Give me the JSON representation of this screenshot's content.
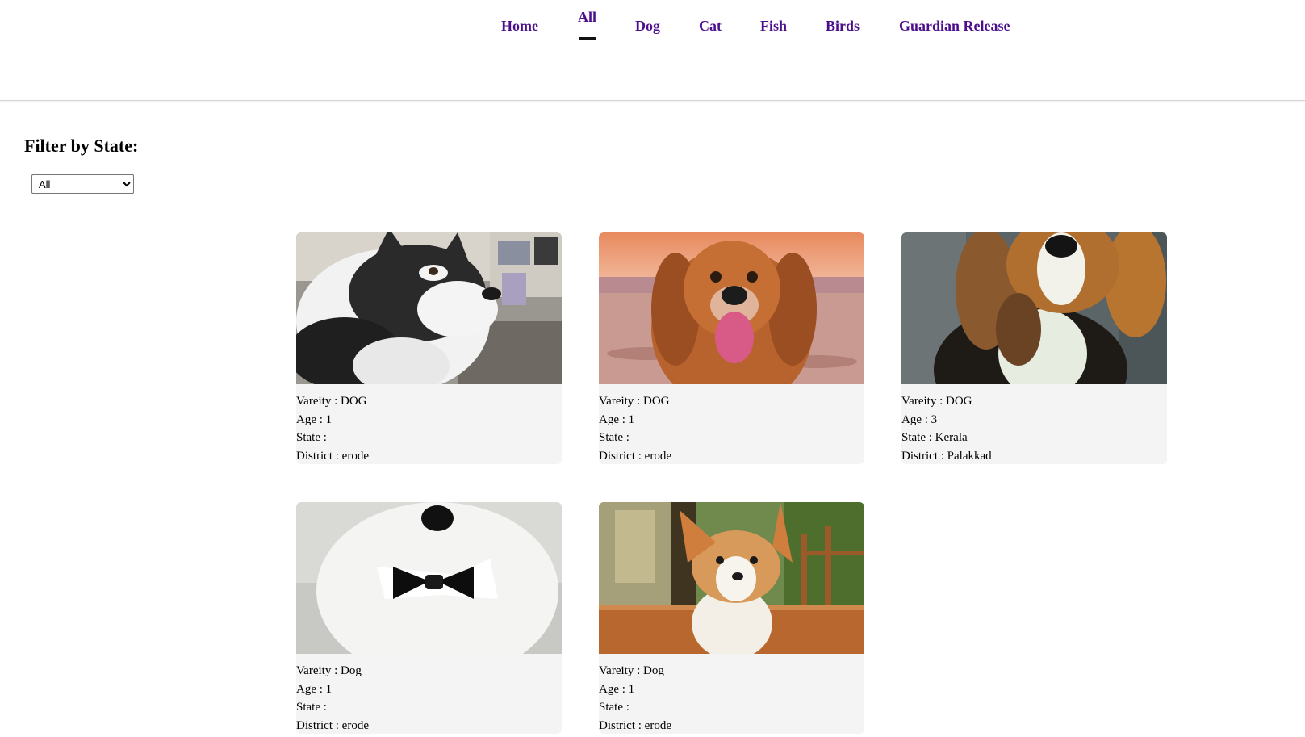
{
  "nav": {
    "items": [
      {
        "label": "Home",
        "active": false
      },
      {
        "label": "All",
        "active": true
      },
      {
        "label": "Dog",
        "active": false
      },
      {
        "label": "Cat",
        "active": false
      },
      {
        "label": "Fish",
        "active": false
      },
      {
        "label": "Birds",
        "active": false
      },
      {
        "label": "Guardian Release",
        "active": false
      }
    ],
    "link_color": "#4b0f8c"
  },
  "filter": {
    "title": "Filter by State:",
    "selected": "All"
  },
  "pets": [
    {
      "image": "husky-puppy-photo",
      "variety_label": "Vareity : ",
      "variety": "DOG",
      "age_label": "Age : ",
      "age": "1",
      "state_label": "State : ",
      "state": "",
      "district_label": "District : ",
      "district": "erode"
    },
    {
      "image": "golden-retriever-beach-photo",
      "variety_label": "Vareity : ",
      "variety": "DOG",
      "age_label": "Age : ",
      "age": "1",
      "state_label": "State : ",
      "state": "",
      "district_label": "District : ",
      "district": "erode"
    },
    {
      "image": "beagle-photo",
      "variety_label": "Vareity : ",
      "variety": "DOG",
      "age_label": "Age : ",
      "age": "3",
      "state_label": "State : ",
      "state": "Kerala",
      "district_label": "District : ",
      "district": "Palakkad"
    },
    {
      "image": "white-dog-bowtie-photo",
      "variety_label": "Vareity : ",
      "variety": "Dog",
      "age_label": "Age : ",
      "age": "1",
      "state_label": "State : ",
      "state": "",
      "district_label": "District : ",
      "district": "erode"
    },
    {
      "image": "corgi-puppy-photo",
      "variety_label": "Vareity : ",
      "variety": "Dog",
      "age_label": "Age : ",
      "age": "1",
      "state_label": "State : ",
      "state": "",
      "district_label": "District : ",
      "district": "erode"
    }
  ]
}
